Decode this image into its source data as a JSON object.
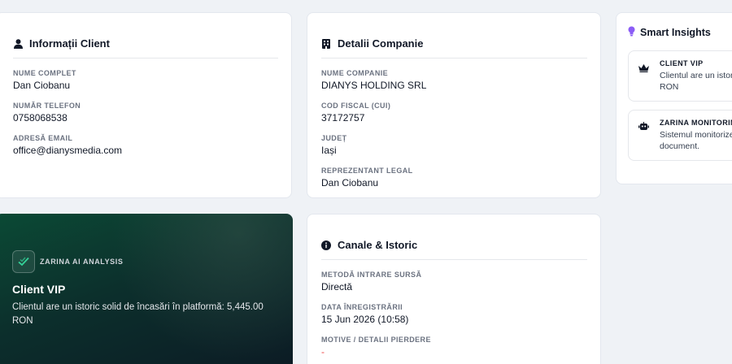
{
  "client_card": {
    "title": "Informații Client",
    "fields": [
      {
        "label": "NUME COMPLET",
        "value": "Dan Ciobanu"
      },
      {
        "label": "NUMĂR TELEFON",
        "value": "0758068538"
      },
      {
        "label": "ADRESĂ EMAIL",
        "value": "office@dianysmedia.com"
      }
    ]
  },
  "company_card": {
    "title": "Detalii Companie",
    "fields": [
      {
        "label": "NUME COMPANIE",
        "value": "DIANYS HOLDING SRL"
      },
      {
        "label": "COD FISCAL (CUI)",
        "value": "37172757"
      },
      {
        "label": "JUDEȚ",
        "value": "Iași"
      },
      {
        "label": "REPREZENTANT LEGAL",
        "value": "Dan Ciobanu"
      }
    ]
  },
  "insights": {
    "title": "Smart Insights",
    "items": [
      {
        "title": "CLIENT VIP",
        "text_line1": "Clientul are un istori",
        "text_line2": "RON",
        "icon": "crown-icon"
      },
      {
        "title": "ZARINA MONITORIN",
        "text_line1": "Sistemul monitorizea",
        "text_line2": "document.",
        "icon": "robot-icon"
      }
    ]
  },
  "zarina": {
    "tag": "ZARINA AI ANALYSIS",
    "title": "Client VIP",
    "text": "Clientul are un istoric solid de încasări în platformă: 5,445.00 RON"
  },
  "canale_card": {
    "title": "Canale & Istoric",
    "fields": [
      {
        "label": "METODĂ INTRARE SURSĂ",
        "value": "Directă"
      },
      {
        "label": "DATA ÎNREGISTRĂRII",
        "value": "15 Jun 2026 (10:58)"
      },
      {
        "label": "MOTIVE / DETALII PIERDERE",
        "value": "-"
      }
    ]
  },
  "colors": {
    "page_bg": "#eff2f6",
    "zarina_green": "#0b4a35",
    "insight_bulb": "#8b5cf6",
    "lost_reason": "#ef4444"
  }
}
